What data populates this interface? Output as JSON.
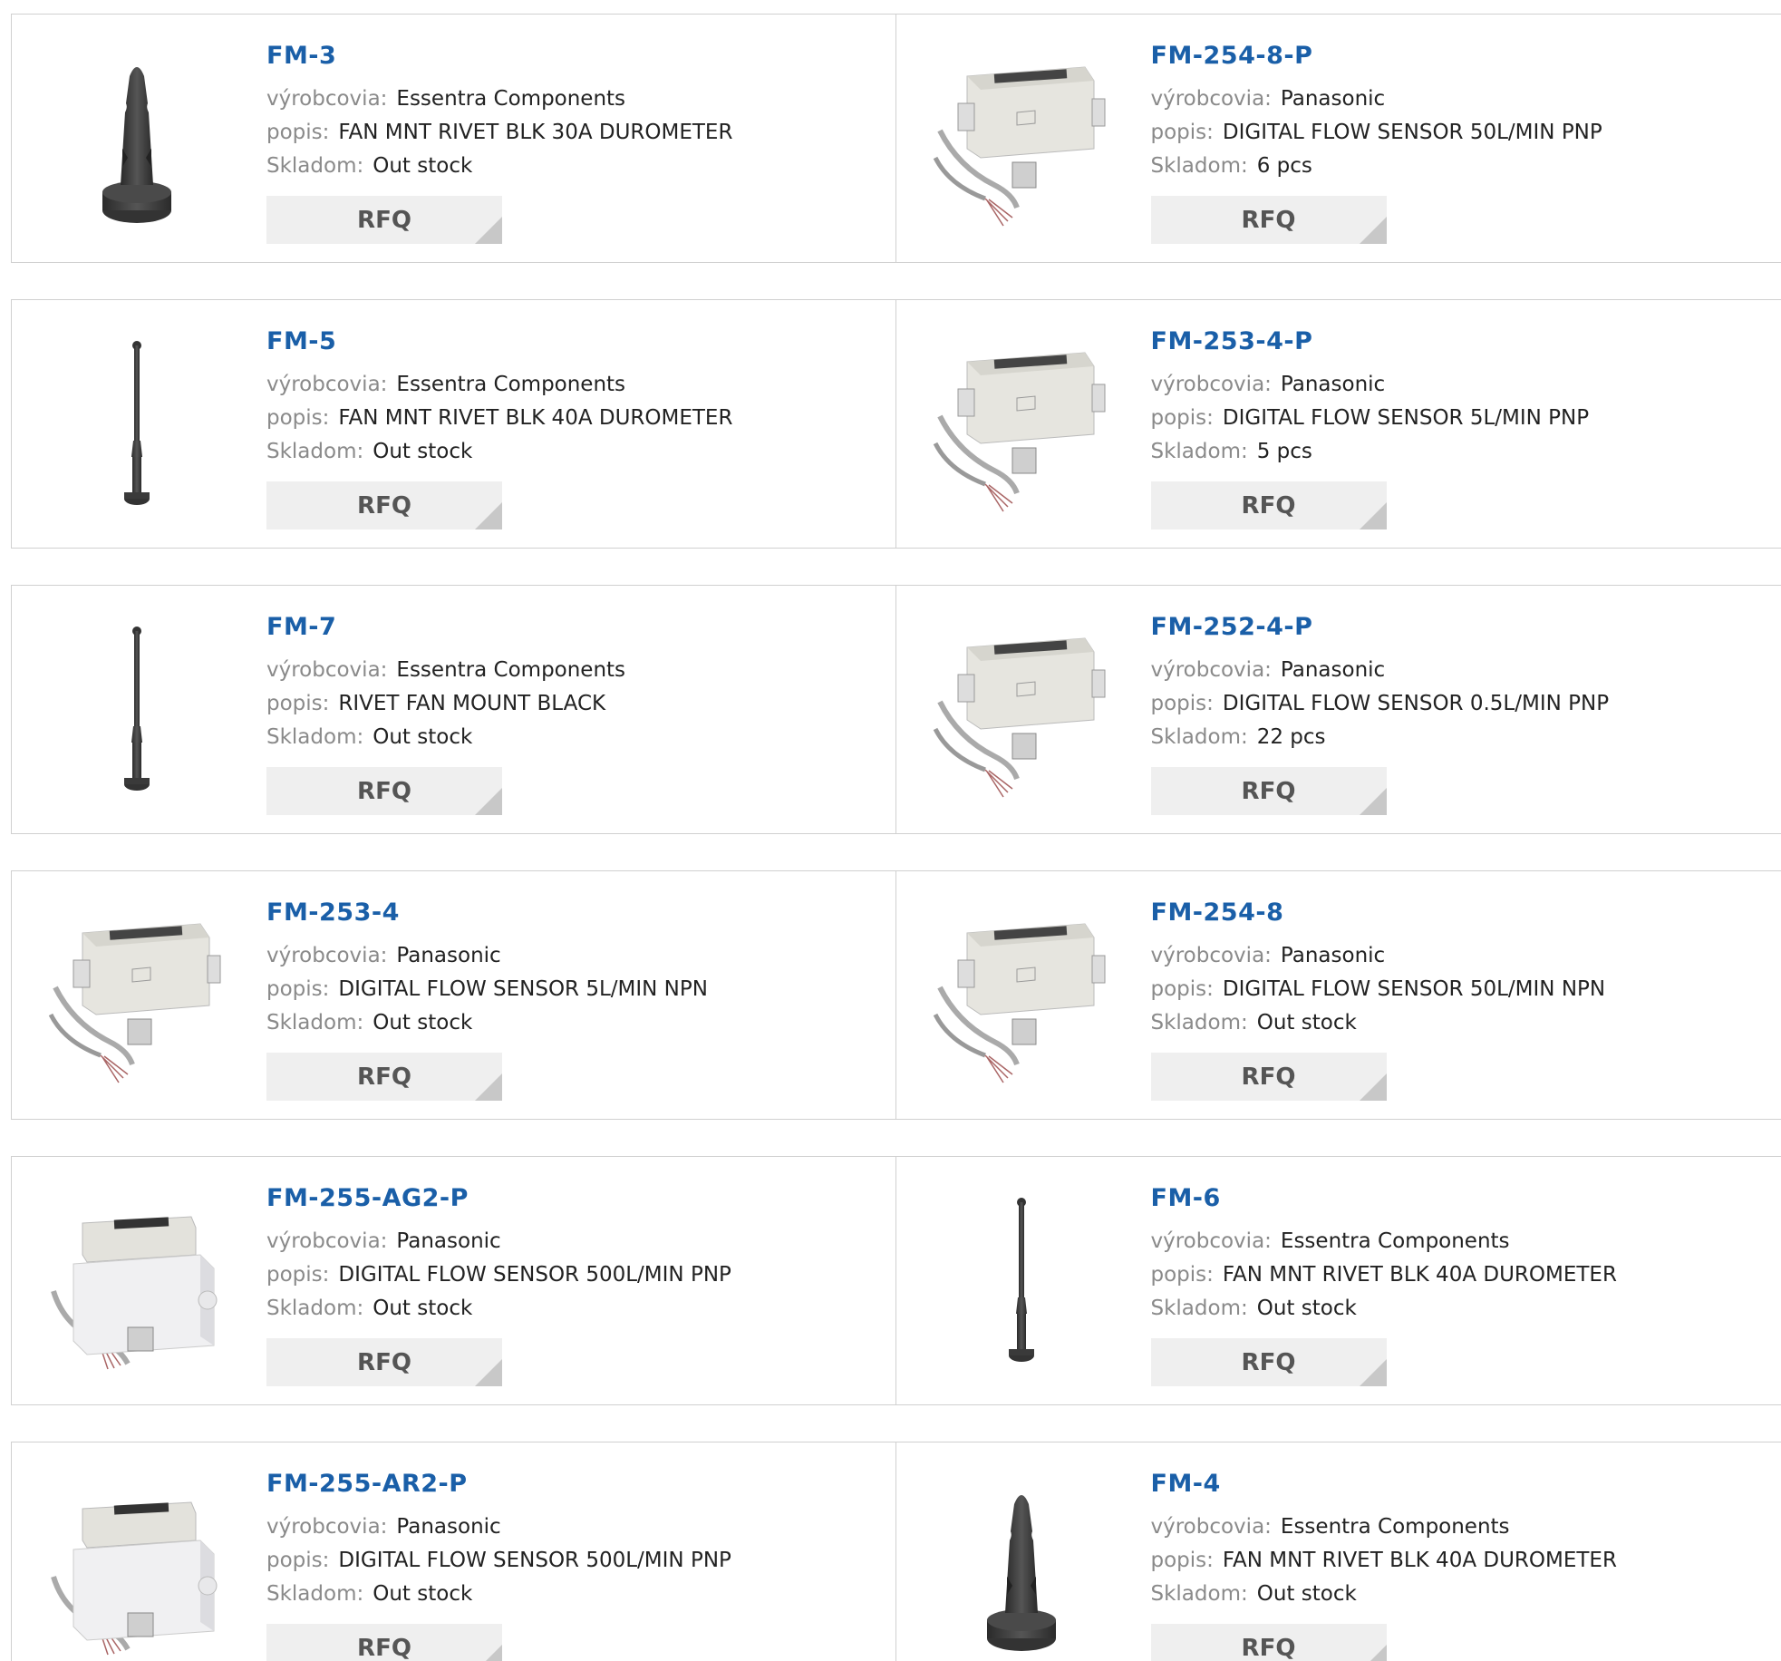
{
  "labels": {
    "manufacturer": "výrobcovia:",
    "description": "popis:",
    "stock": "Skladom:",
    "rfq": "RFQ"
  },
  "products": [
    {
      "name": "FM-3",
      "manufacturer": "Essentra Components",
      "description": "FAN MNT RIVET BLK 30A DUROMETER",
      "stock": "Out stock",
      "image": "rivet-wide-icon"
    },
    {
      "name": "FM-254-8-P",
      "manufacturer": "Panasonic",
      "description": "DIGITAL FLOW SENSOR 50L/MIN PNP",
      "stock": "6 pcs",
      "image": "flow-sensor-icon"
    },
    {
      "name": "FM-5",
      "manufacturer": "Essentra Components",
      "description": "FAN MNT RIVET BLK 40A DUROMETER",
      "stock": "Out stock",
      "image": "rivet-thin-icon"
    },
    {
      "name": "FM-253-4-P",
      "manufacturer": "Panasonic",
      "description": "DIGITAL FLOW SENSOR 5L/MIN PNP",
      "stock": "5 pcs",
      "image": "flow-sensor-icon"
    },
    {
      "name": "FM-7",
      "manufacturer": "Essentra Components",
      "description": "RIVET FAN MOUNT BLACK",
      "stock": "Out stock",
      "image": "rivet-thin-icon"
    },
    {
      "name": "FM-252-4-P",
      "manufacturer": "Panasonic",
      "description": "DIGITAL FLOW SENSOR 0.5L/MIN PNP",
      "stock": "22 pcs",
      "image": "flow-sensor-icon"
    },
    {
      "name": "FM-253-4",
      "manufacturer": "Panasonic",
      "description": "DIGITAL FLOW SENSOR 5L/MIN NPN",
      "stock": "Out stock",
      "image": "flow-sensor-icon"
    },
    {
      "name": "FM-254-8",
      "manufacturer": "Panasonic",
      "description": "DIGITAL FLOW SENSOR 50L/MIN NPN",
      "stock": "Out stock",
      "image": "flow-sensor-icon"
    },
    {
      "name": "FM-255-AG2-P",
      "manufacturer": "Panasonic",
      "description": "DIGITAL FLOW SENSOR 500L/MIN PNP",
      "stock": "Out stock",
      "image": "flow-sensor-block-icon"
    },
    {
      "name": "FM-6",
      "manufacturer": "Essentra Components",
      "description": "FAN MNT RIVET BLK 40A DUROMETER",
      "stock": "Out stock",
      "image": "rivet-thin-icon"
    },
    {
      "name": "FM-255-AR2-P",
      "manufacturer": "Panasonic",
      "description": "DIGITAL FLOW SENSOR 500L/MIN PNP",
      "stock": "Out stock",
      "image": "flow-sensor-block-icon"
    },
    {
      "name": "FM-4",
      "manufacturer": "Essentra Components",
      "description": "FAN MNT RIVET BLK 40A DUROMETER",
      "stock": "Out stock",
      "image": "rivet-wide-icon"
    }
  ]
}
